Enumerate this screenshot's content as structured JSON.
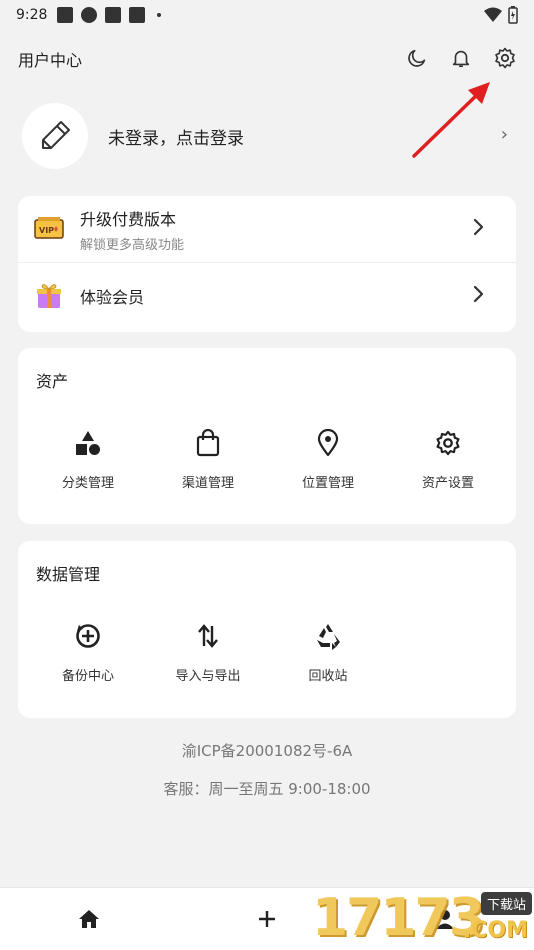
{
  "status_bar": {
    "time": "9:28"
  },
  "header": {
    "title": "用户中心"
  },
  "profile": {
    "login_prompt": "未登录，点击登录",
    "chevron": "›"
  },
  "upgrade_card": {
    "items": [
      {
        "title": "升级付费版本",
        "subtitle": "解锁更多高级功能",
        "icon": "vip-ticket-icon"
      },
      {
        "title": "体验会员",
        "icon": "gift-icon"
      }
    ]
  },
  "assets": {
    "title": "资产",
    "items": [
      {
        "label": "分类管理",
        "icon": "shapes-icon"
      },
      {
        "label": "渠道管理",
        "icon": "shopping-bag-icon"
      },
      {
        "label": "位置管理",
        "icon": "location-pin-icon"
      },
      {
        "label": "资产设置",
        "icon": "gear-icon"
      }
    ]
  },
  "data_management": {
    "title": "数据管理",
    "items": [
      {
        "label": "备份中心",
        "icon": "backup-icon"
      },
      {
        "label": "导入与导出",
        "icon": "import-export-icon"
      },
      {
        "label": "回收站",
        "icon": "recycle-icon"
      }
    ]
  },
  "footer": {
    "icp": "渝ICP备20001082号-6A",
    "service": "客服：周一至周五 9:00-18:00"
  },
  "watermark": {
    "number": "17173",
    "tag": "下载站",
    "domain": ".COM"
  },
  "colors": {
    "annotation_arrow": "#e02020",
    "watermark_gold": "#f0c34a"
  }
}
